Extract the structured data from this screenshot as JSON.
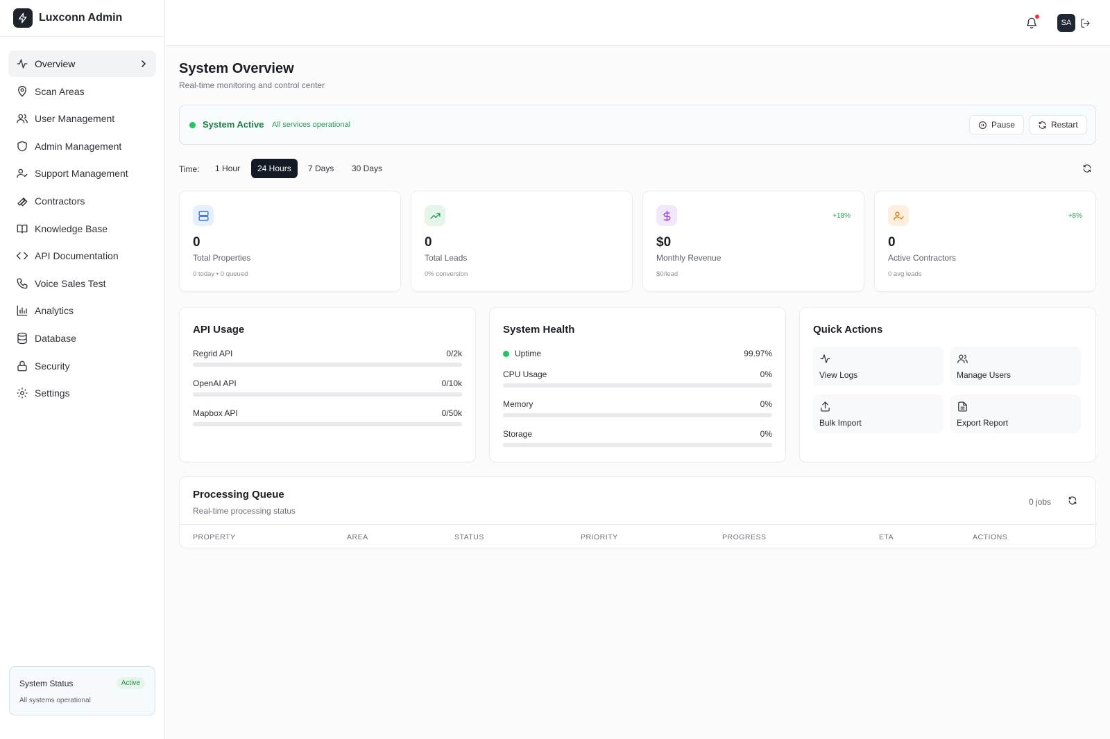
{
  "app": {
    "name": "Luxconn Admin"
  },
  "sidebar": {
    "items": [
      {
        "label": "Overview",
        "icon": "activity-icon"
      },
      {
        "label": "Scan Areas",
        "icon": "map-pin-icon"
      },
      {
        "label": "User Management",
        "icon": "users-icon"
      },
      {
        "label": "Admin Management",
        "icon": "shield-icon"
      },
      {
        "label": "Support Management",
        "icon": "user-check-icon"
      },
      {
        "label": "Contractors",
        "icon": "wrench-icon"
      },
      {
        "label": "Knowledge Base",
        "icon": "book-icon"
      },
      {
        "label": "API Documentation",
        "icon": "code-icon"
      },
      {
        "label": "Voice Sales Test",
        "icon": "phone-icon"
      },
      {
        "label": "Analytics",
        "icon": "bar-chart-icon"
      },
      {
        "label": "Database",
        "icon": "database-icon"
      },
      {
        "label": "Security",
        "icon": "lock-icon"
      },
      {
        "label": "Settings",
        "icon": "gear-icon"
      }
    ],
    "system_status": {
      "title": "System Status",
      "badge": "Active",
      "sub": "All systems operational"
    }
  },
  "topbar": {
    "avatar": "SA"
  },
  "page": {
    "title": "System Overview",
    "subtitle": "Real-time monitoring and control center"
  },
  "status": {
    "title": "System Active",
    "sub": "All services operational",
    "pause": "Pause",
    "restart": "Restart"
  },
  "time": {
    "label": "Time:",
    "options": [
      "1 Hour",
      "24 Hours",
      "7 Days",
      "30 Days"
    ],
    "selected": "24 Hours"
  },
  "stats": [
    {
      "value": "0",
      "label": "Total Properties",
      "sub": "0 today • 0 queued",
      "change": "",
      "icon": "server-icon"
    },
    {
      "value": "0",
      "label": "Total Leads",
      "sub": "0% conversion",
      "change": "",
      "icon": "trending-up-icon"
    },
    {
      "value": "$0",
      "label": "Monthly Revenue",
      "sub": "$0/lead",
      "change": "+18%",
      "icon": "dollar-icon"
    },
    {
      "value": "0",
      "label": "Active Contractors",
      "sub": "0 avg leads",
      "change": "+8%",
      "icon": "user-check-icon"
    }
  ],
  "api_usage": {
    "title": "API Usage",
    "rows": [
      {
        "label": "Regrid API",
        "value": "0/2k",
        "fraction": 0
      },
      {
        "label": "OpenAI API",
        "value": "0/10k",
        "fraction": 0
      },
      {
        "label": "Mapbox API",
        "value": "0/50k",
        "fraction": 0
      }
    ]
  },
  "system_health": {
    "title": "System Health",
    "uptime": {
      "label": "Uptime",
      "value": "99.97%"
    },
    "rows": [
      {
        "label": "CPU Usage",
        "value": "0%",
        "fraction": 0
      },
      {
        "label": "Memory",
        "value": "0%",
        "fraction": 0
      },
      {
        "label": "Storage",
        "value": "0%",
        "fraction": 0
      }
    ]
  },
  "quick_actions": {
    "title": "Quick Actions",
    "items": [
      {
        "label": "View Logs",
        "icon": "activity-icon"
      },
      {
        "label": "Manage Users",
        "icon": "users-icon"
      },
      {
        "label": "Bulk Import",
        "icon": "upload-icon"
      },
      {
        "label": "Export Report",
        "icon": "file-text-icon"
      }
    ]
  },
  "queue": {
    "title": "Processing Queue",
    "sub": "Real-time processing status",
    "jobs": "0 jobs",
    "columns": [
      "PROPERTY",
      "AREA",
      "STATUS",
      "PRIORITY",
      "PROGRESS",
      "ETA",
      "ACTIONS"
    ]
  },
  "colors": {
    "accent": "#141a23",
    "success": "#22c55e",
    "success_text": "#1e7d41"
  }
}
